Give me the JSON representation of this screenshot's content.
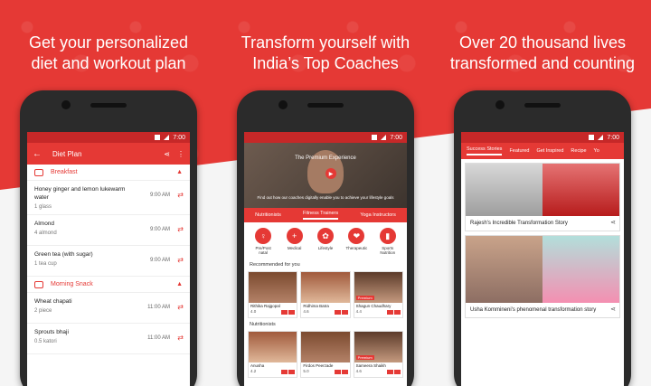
{
  "captions": [
    {
      "line1": "Get your personalized",
      "line2": "diet and workout plan"
    },
    {
      "line1": "Transform yourself with",
      "line2": "India’s Top Coaches"
    },
    {
      "line1": "Over 20 thousand lives",
      "line2": "transformed and counting"
    }
  ],
  "status": {
    "time": "7:00"
  },
  "diet": {
    "title": "Diet Plan",
    "breakfast": "Breakfast",
    "snack": "Morning Snack",
    "meals": [
      {
        "name": "Honey ginger and lemon lukewarm water",
        "qty": "1 glass",
        "time": "9:00 AM"
      },
      {
        "name": "Almond",
        "qty": "4 almond",
        "time": "9:00 AM"
      },
      {
        "name": "Green tea (with sugar)",
        "qty": "1 tea cup",
        "time": "9:00 AM"
      }
    ],
    "snacks": [
      {
        "name": "Wheat chapati",
        "qty": "2 piece",
        "time": "11:00 AM"
      },
      {
        "name": "Sprouts bhaji",
        "qty": "0.5 katori",
        "time": "11:00 AM"
      }
    ]
  },
  "coaches": {
    "hero_title": "The Premium Experience",
    "hero_sub": "Find out how our coaches digitally enable you to achieve your lifestyle goals",
    "tabs": [
      "Nutritionists",
      "Fitness Trainers",
      "Yoga Instructors"
    ],
    "categories": [
      "Pre/Post natal",
      "Medical",
      "Lifestyle",
      "Therapeutic",
      "Sports Nutrition"
    ],
    "recommended": "Recommended for you",
    "nutritionists": "Nutritionists",
    "row1": [
      {
        "name": "Rithika Rajgopal",
        "rating": "4.0"
      },
      {
        "name": "Ridhima Batra",
        "rating": "4.6"
      },
      {
        "name": "Shagun Chaudhary",
        "rating": "4.4",
        "badge": "Premium"
      }
    ],
    "row2": [
      {
        "name": "Anusha",
        "rating": "4.2"
      },
      {
        "name": "Firdos Peerzade",
        "rating": "5.0"
      },
      {
        "name": "Sameera Shaikh",
        "rating": "4.6",
        "badge": "Premium"
      }
    ]
  },
  "stories": {
    "tabs": [
      "Success Stories",
      "Featured",
      "Get Inspired",
      "Recipe",
      "Yo"
    ],
    "items": [
      {
        "title": "Rajesh's Incredible Transformation Story"
      },
      {
        "title": "Usha Kommineni's phenomenal transformation story"
      }
    ]
  }
}
